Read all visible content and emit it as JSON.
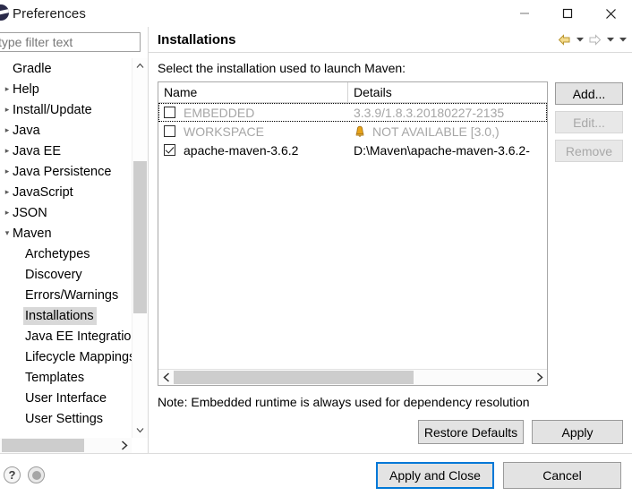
{
  "window": {
    "title": "Preferences",
    "icon": "eclipse-icon",
    "controls": {
      "minimize": "minimize-icon",
      "maximize": "maximize-icon",
      "close": "close-icon"
    }
  },
  "sidebar": {
    "filter": {
      "placeholder": "type filter text",
      "value": ""
    },
    "items": [
      {
        "label": "Gradle",
        "level": 0,
        "twisty": "",
        "selected": false
      },
      {
        "label": "Help",
        "level": 0,
        "twisty": "▸",
        "selected": false
      },
      {
        "label": "Install/Update",
        "level": 0,
        "twisty": "▸",
        "selected": false
      },
      {
        "label": "Java",
        "level": 0,
        "twisty": "▸",
        "selected": false
      },
      {
        "label": "Java EE",
        "level": 0,
        "twisty": "▸",
        "selected": false
      },
      {
        "label": "Java Persistence",
        "level": 0,
        "twisty": "▸",
        "selected": false
      },
      {
        "label": "JavaScript",
        "level": 0,
        "twisty": "▸",
        "selected": false
      },
      {
        "label": "JSON",
        "level": 0,
        "twisty": "▸",
        "selected": false
      },
      {
        "label": "Maven",
        "level": 0,
        "twisty": "▾",
        "selected": false
      },
      {
        "label": "Archetypes",
        "level": 1,
        "twisty": "",
        "selected": false
      },
      {
        "label": "Discovery",
        "level": 1,
        "twisty": "",
        "selected": false
      },
      {
        "label": "Errors/Warnings",
        "level": 1,
        "twisty": "",
        "selected": false
      },
      {
        "label": "Installations",
        "level": 1,
        "twisty": "",
        "selected": true
      },
      {
        "label": "Java EE Integration",
        "level": 1,
        "twisty": "",
        "selected": false
      },
      {
        "label": "Lifecycle Mappings",
        "level": 1,
        "twisty": "",
        "selected": false
      },
      {
        "label": "Templates",
        "level": 1,
        "twisty": "",
        "selected": false
      },
      {
        "label": "User Interface",
        "level": 1,
        "twisty": "",
        "selected": false
      },
      {
        "label": "User Settings",
        "level": 1,
        "twisty": "",
        "selected": false
      }
    ],
    "scroll_up_icon": "chevron-up-icon",
    "scroll_down_icon": "chevron-down-icon",
    "hscroll_right_icon": "chevron-right-icon"
  },
  "page": {
    "title": "Installations",
    "nav": {
      "back_icon": "back-arrow-icon",
      "back_caret_icon": "chevron-down-icon",
      "forward_icon": "forward-arrow-icon",
      "forward_caret_icon": "chevron-down-icon",
      "menu_caret_icon": "chevron-down-icon"
    },
    "intro": "Select the installation used to launch Maven:",
    "table": {
      "columns": [
        "Name",
        "Details"
      ],
      "rows": [
        {
          "checked": false,
          "name": "EMBEDDED",
          "details": "3.3.9/1.8.3.20180227-2135",
          "dim": true,
          "warning": false,
          "focused": true
        },
        {
          "checked": false,
          "name": "WORKSPACE",
          "details": "NOT AVAILABLE [3.0,)",
          "dim": true,
          "warning": true,
          "focused": false
        },
        {
          "checked": true,
          "name": "apache-maven-3.6.2",
          "details": "D:\\Maven\\apache-maven-3.6.2-",
          "dim": false,
          "warning": false,
          "focused": false
        }
      ],
      "hscroll_left_icon": "chevron-left-icon",
      "hscroll_right_icon": "chevron-right-icon"
    },
    "side_buttons": [
      {
        "label": "Add...",
        "enabled": true
      },
      {
        "label": "Edit...",
        "enabled": false
      },
      {
        "label": "Remove",
        "enabled": false
      }
    ],
    "note": "Note: Embedded runtime is always used for dependency resolution",
    "actions": {
      "restore_defaults": "Restore Defaults",
      "apply": "Apply"
    }
  },
  "footer": {
    "help_icon": "question-mark-icon",
    "settings_icon": "circle-icon",
    "apply_and_close": "Apply and Close",
    "cancel": "Cancel"
  },
  "colors": {
    "focus_blue": "#0078d7",
    "selection_gray": "#d8d8d8",
    "disabled_text": "#a8a8a8",
    "dim_text": "#a6a6a6",
    "warning_yellow": "#e8a317"
  }
}
